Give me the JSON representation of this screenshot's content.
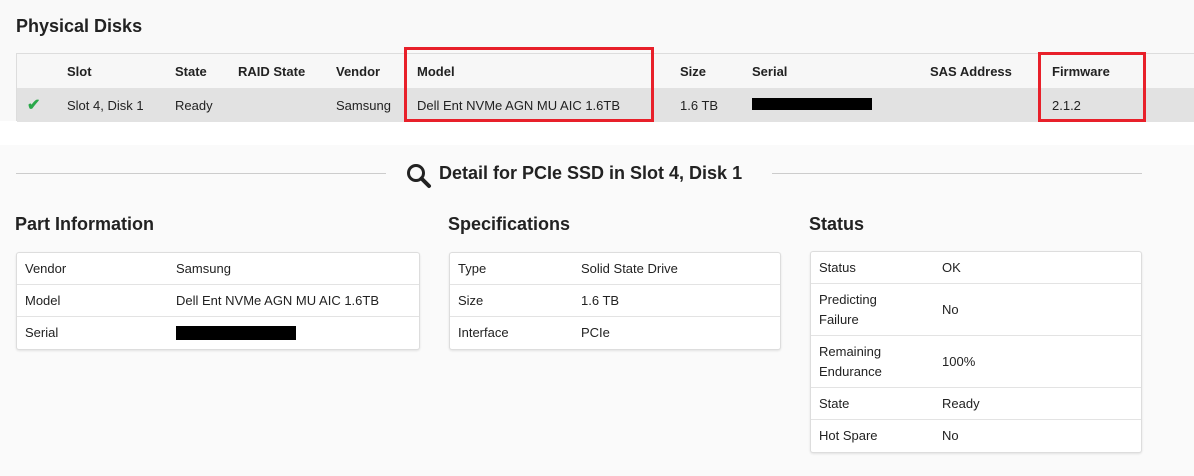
{
  "physical_disks": {
    "title": "Physical Disks",
    "columns": [
      "Slot",
      "State",
      "RAID State",
      "Vendor",
      "Model",
      "Size",
      "Serial",
      "SAS Address",
      "Firmware"
    ],
    "rows": [
      {
        "status_icon": "check-icon",
        "slot": "Slot 4, Disk 1",
        "state": "Ready",
        "raid_state": "",
        "vendor": "Samsung",
        "model": "Dell Ent NVMe AGN MU AIC 1.6TB",
        "size": "1.6 TB",
        "serial": "[redacted]",
        "sas_address": "",
        "firmware": "2.1.2"
      }
    ]
  },
  "detail": {
    "title": "Detail for PCIe SSD in Slot 4, Disk 1",
    "icon": "search-icon"
  },
  "part_info": {
    "title": "Part Information",
    "rows": [
      {
        "k": "Vendor",
        "v": "Samsung"
      },
      {
        "k": "Model",
        "v": "Dell Ent NVMe AGN MU AIC 1.6TB"
      },
      {
        "k": "Serial",
        "v": "[redacted]"
      }
    ]
  },
  "specs": {
    "title": "Specifications",
    "rows": [
      {
        "k": "Type",
        "v": "Solid State Drive"
      },
      {
        "k": "Size",
        "v": "1.6 TB"
      },
      {
        "k": "Interface",
        "v": "PCIe"
      }
    ]
  },
  "status": {
    "title": "Status",
    "rows": [
      {
        "k": "Status",
        "v": "OK"
      },
      {
        "k": "Predicting Failure",
        "v": "No"
      },
      {
        "k": "Remaining Endurance",
        "v": "100%"
      },
      {
        "k": "State",
        "v": "Ready"
      },
      {
        "k": "Hot Spare",
        "v": "No"
      }
    ]
  },
  "colors": {
    "highlight": "#e8202a",
    "check": "#2aa84a"
  }
}
